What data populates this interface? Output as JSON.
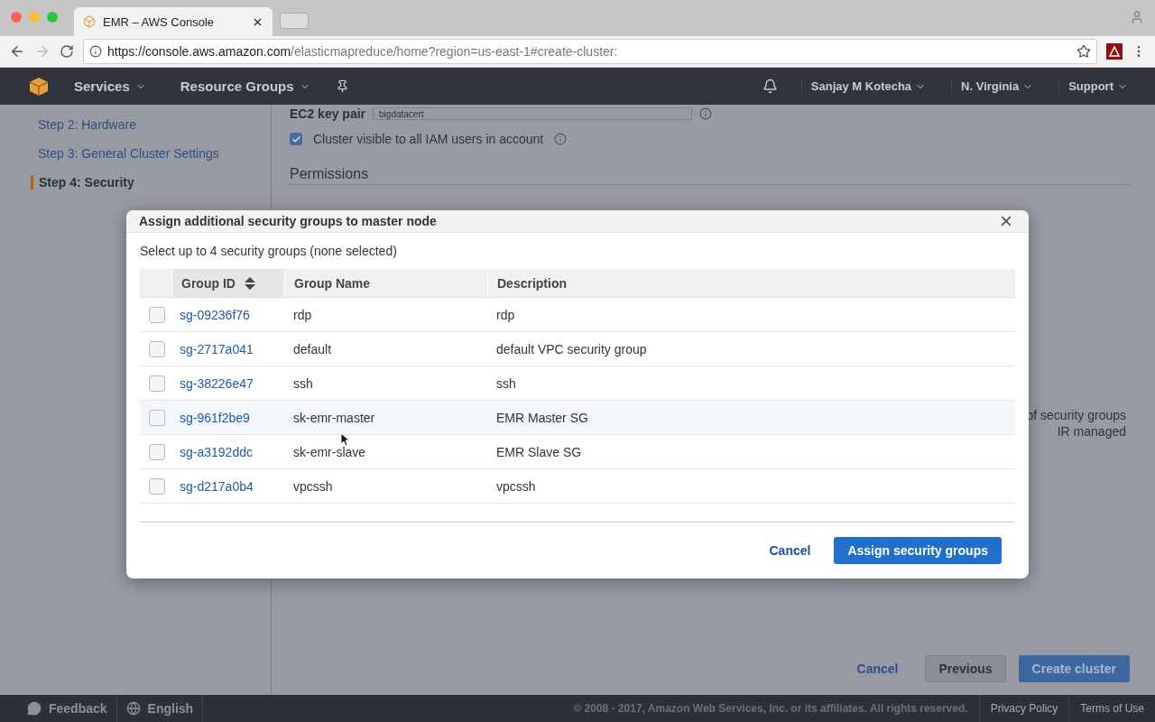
{
  "browser": {
    "tab_title": "EMR – AWS Console",
    "url_host": "https://console.aws.amazon.com",
    "url_path": "/elasticmapreduce/home?region=us-east-1#create-cluster:"
  },
  "nav": {
    "left": [
      "Services",
      "Resource Groups"
    ],
    "right": [
      "Sanjay M Kotecha",
      "N. Virginia",
      "Support"
    ]
  },
  "sidebar": {
    "items": [
      {
        "label": "Step 2: Hardware",
        "selected": false
      },
      {
        "label": "Step 3: General Cluster Settings",
        "selected": false
      },
      {
        "label": "Step 4: Security",
        "selected": true
      }
    ]
  },
  "form": {
    "key_pair_label": "EC2 key pair",
    "key_pair_value": "bigdatacert",
    "visible_checkbox": {
      "label": "Cluster visible to all IAM users in account",
      "checked": true
    },
    "permissions_heading": "Permissions",
    "side_note": [
      "of security groups",
      "IR managed"
    ]
  },
  "page_buttons": {
    "cancel": "Cancel",
    "previous": "Previous",
    "create": "Create cluster"
  },
  "dialog": {
    "title": "Assign additional security groups to master node",
    "close": "×",
    "subtitle": "Select up to 4 security groups (none selected)",
    "columns": [
      "Group ID",
      "Group Name",
      "Description"
    ],
    "rows": [
      {
        "id": "sg-09236f76",
        "name": "rdp",
        "description": "rdp",
        "checked": false,
        "hovered": false
      },
      {
        "id": "sg-2717a041",
        "name": "default",
        "description": "default VPC security group",
        "checked": false,
        "hovered": false
      },
      {
        "id": "sg-38226e47",
        "name": "ssh",
        "description": "ssh",
        "checked": false,
        "hovered": false
      },
      {
        "id": "sg-961f2be9",
        "name": "sk-emr-master",
        "description": "EMR Master SG",
        "checked": false,
        "hovered": true
      },
      {
        "id": "sg-a3192ddc",
        "name": "sk-emr-slave",
        "description": "EMR Slave SG",
        "checked": false,
        "hovered": false
      },
      {
        "id": "sg-d217a0b4",
        "name": "vpcssh",
        "description": "vpcssh",
        "checked": false,
        "hovered": false
      }
    ],
    "cancel": "Cancel",
    "assign": "Assign security groups"
  },
  "footer": {
    "feedback": "Feedback",
    "language": "English",
    "copyright": "© 2008 - 2017, Amazon Web Services, Inc. or its affiliates. All rights reserved.",
    "links": [
      "Privacy Policy",
      "Terms of Use"
    ]
  }
}
